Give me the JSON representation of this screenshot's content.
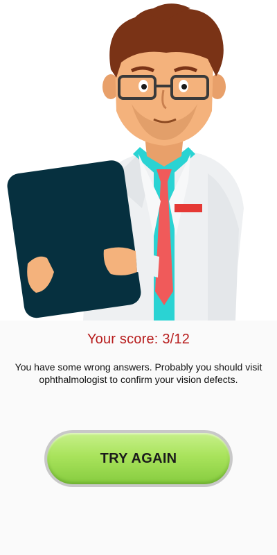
{
  "result": {
    "score_text": "Your score: 3/12",
    "message": "You have some wrong answers. Probably you should visit ophthalmologist to confirm your vision defects.",
    "score_color": "#b71c1c"
  },
  "actions": {
    "try_again_label": "TRY AGAIN",
    "button_color": "#a9e35c"
  },
  "illustration": {
    "icon": "doctor-with-clipboard-illustration"
  }
}
